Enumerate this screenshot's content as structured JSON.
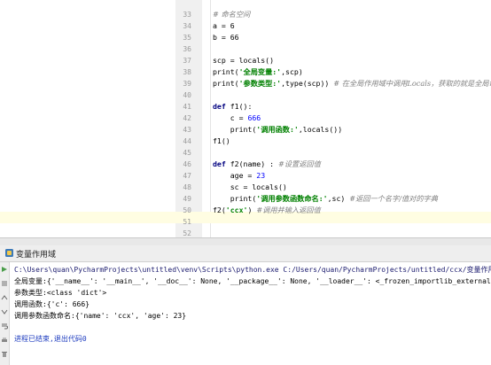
{
  "editor": {
    "line_numbers": [
      "33",
      "34",
      "35",
      "36",
      "37",
      "38",
      "39",
      "40",
      "41",
      "42",
      "43",
      "44",
      "45",
      "46",
      "47",
      "48",
      "49",
      "50",
      "51",
      "52"
    ],
    "lines": {
      "l33_comment": "# 命名空间",
      "l34": "a = 6",
      "l35": "b = 66",
      "l37": "scp = locals()",
      "l38_fn": "print(",
      "l38_str": "'全局变量:'",
      "l38_rest": ",scp)",
      "l39_fn": "print(",
      "l39_str": "'参数类型:'",
      "l39_rest": ",type(scp)) ",
      "l39_comment": "# 在全局作用域中调用Locals，获取的就是全局命",
      "l41_kw": "def",
      "l41_rest": " f1():",
      "l42_var": "    c = ",
      "l42_num": "666",
      "l43_fn": "    print(",
      "l43_str": "'调用函数:'",
      "l43_rest": ",locals())",
      "l44": "f1()",
      "l46_kw": "def",
      "l46_rest": " f2(name) : ",
      "l46_comment": "#设置返回值",
      "l47_var": "    age = ",
      "l47_num": "23",
      "l48": "    sc = locals()",
      "l49_fn": "    print(",
      "l49_str": "'调用参数函数命名:'",
      "l49_rest": ",sc) ",
      "l49_comment": "#返回一个名字/值对的字典",
      "l50_fn": "f2(",
      "l50_str": "'ccx'",
      "l50_rest": ") ",
      "l50_comment": "#调用并输入返回值"
    }
  },
  "run_panel": {
    "tab_title": "变量作用域",
    "console_lines": {
      "command": "C:\\Users\\quan\\PycharmProjects\\untitled\\venv\\Scripts\\python.exe C:/Users/quan/PycharmProjects/untitled/ccx/变量作用域.py",
      "out1": "全局变量:{'__name__': '__main__', '__doc__': None, '__package__': None, '__loader__': <_frozen_importlib_external.SourceF",
      "out2": "参数类型:<class 'dict'>",
      "out3": "调用函数:{'c': 666}",
      "out4": "调用参数函数命名:{'name': 'ccx', 'age': 23}",
      "exit": "进程已结束,退出代码0"
    }
  },
  "icons": {
    "run_tab": "python-file-icon",
    "toolbar": [
      "rerun-icon",
      "stop-icon",
      "scroll-up-icon",
      "scroll-down-icon",
      "wrap-icon",
      "print-icon",
      "clear-icon"
    ]
  },
  "colors": {
    "keyword": "#000080",
    "number": "#0000ff",
    "string": "#008000",
    "comment": "#808080",
    "caret_line": "#fffde2",
    "gutter": "#f0f0f0"
  }
}
